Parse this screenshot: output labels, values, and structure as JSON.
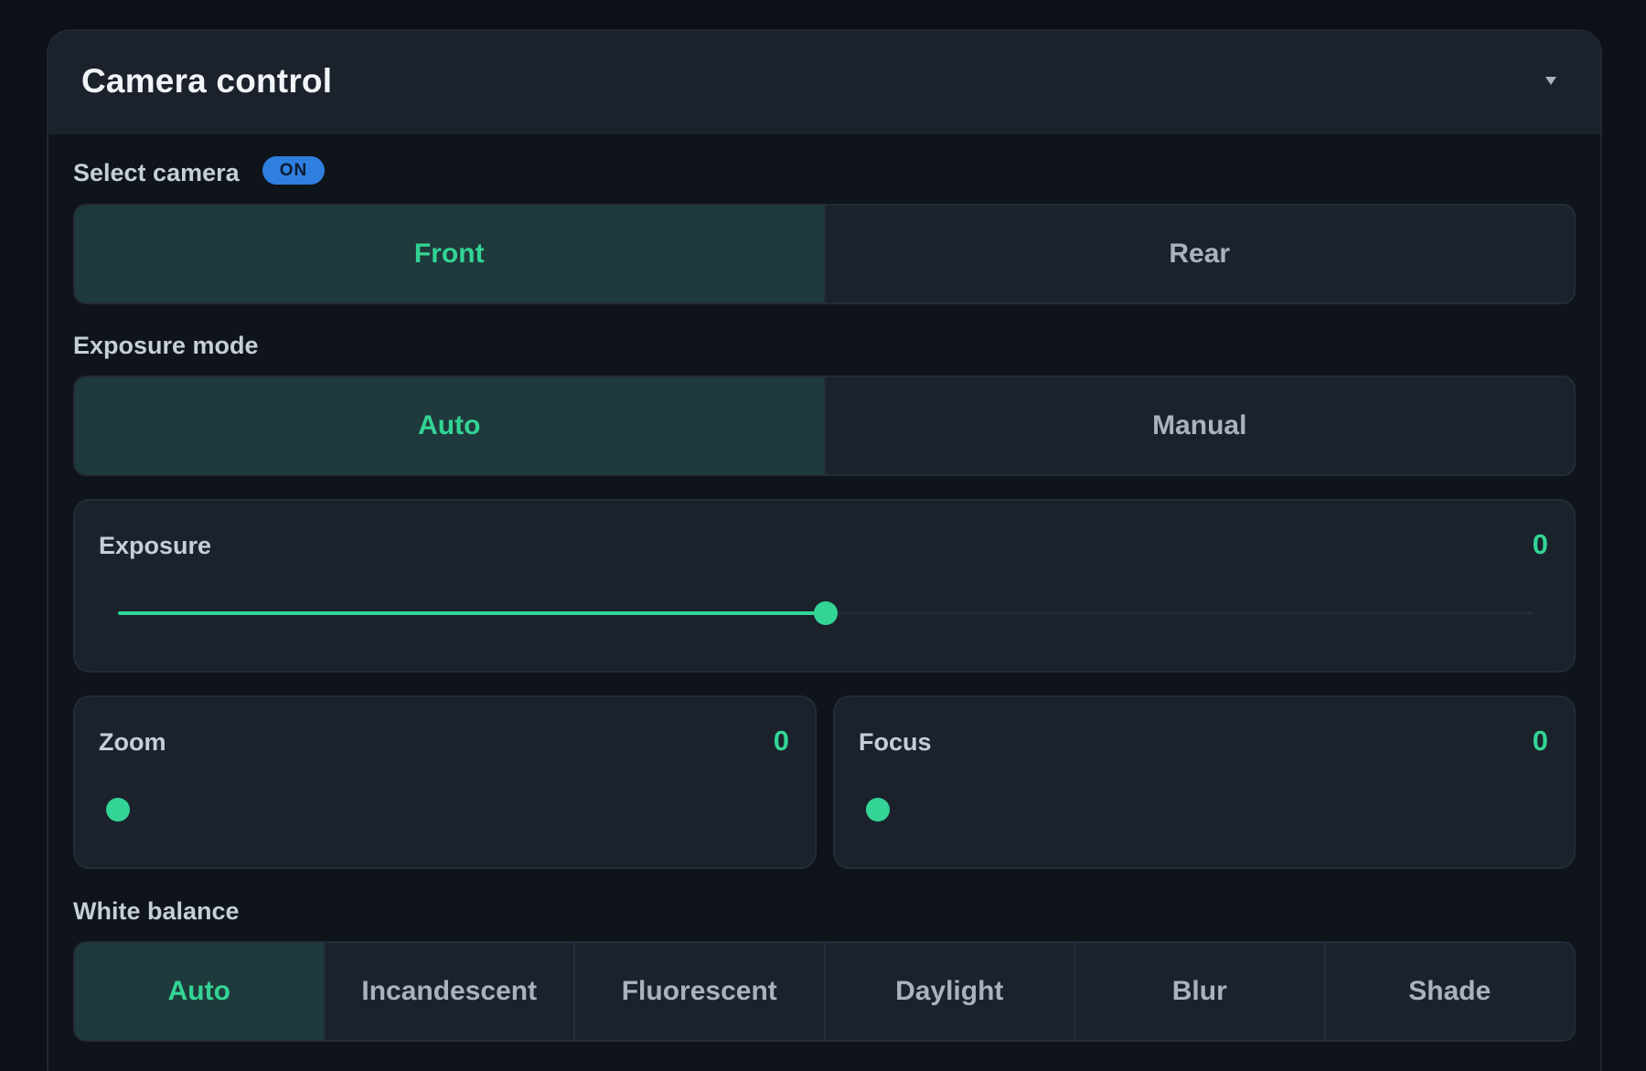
{
  "panel": {
    "title": "Camera control",
    "collapse_icon": "chevron-down-icon"
  },
  "select_camera": {
    "label": "Select camera",
    "badge": "ON",
    "options": [
      "Front",
      "Rear"
    ],
    "selected": "Front"
  },
  "exposure_mode": {
    "label": "Exposure mode",
    "options": [
      "Auto",
      "Manual"
    ],
    "selected": "Auto"
  },
  "exposure": {
    "label": "Exposure",
    "value": "0",
    "slider_fraction": 0.5
  },
  "zoom": {
    "label": "Zoom",
    "value": "0",
    "slider_fraction": 0
  },
  "focus": {
    "label": "Focus",
    "value": "0",
    "slider_fraction": 0
  },
  "white_balance": {
    "label": "White balance",
    "options": [
      "Auto",
      "Incandescent",
      "Fluorescent",
      "Daylight",
      "Blur",
      "Shade"
    ],
    "selected": "Auto"
  },
  "colors": {
    "accent": "#33d495",
    "badge": "#2f7fe0",
    "panel_header": "#1b222c",
    "background": "#0d1117"
  }
}
